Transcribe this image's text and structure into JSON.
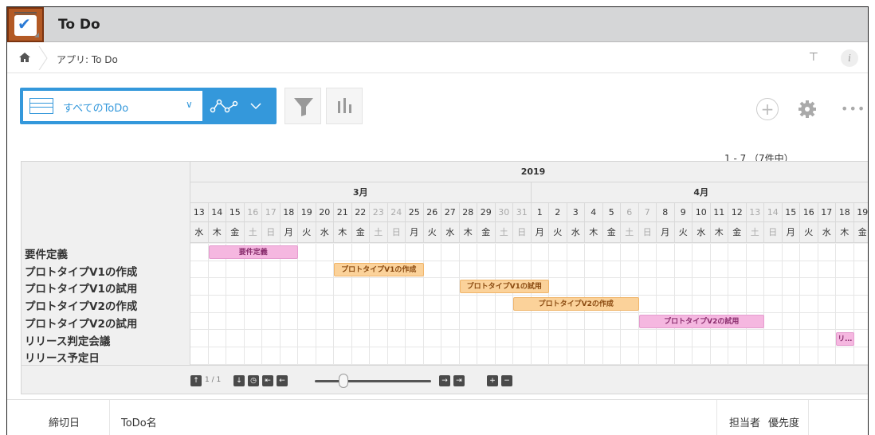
{
  "app": {
    "title": "To Do"
  },
  "breadcrumb": {
    "text": "アプリ: To Do"
  },
  "toolbar": {
    "view_name": "すべてのToDo"
  },
  "pager": {
    "count": "1 - 7 （7件中）"
  },
  "gantt": {
    "year": "2019",
    "months": [
      {
        "label": "3月"
      },
      {
        "label": "4月"
      }
    ],
    "days": [
      "13",
      "14",
      "15",
      "16",
      "17",
      "18",
      "19",
      "20",
      "21",
      "22",
      "23",
      "24",
      "25",
      "26",
      "27",
      "28",
      "29",
      "30",
      "31",
      "1",
      "2",
      "3",
      "4",
      "5",
      "6",
      "7",
      "8",
      "9",
      "10",
      "11",
      "12",
      "13",
      "14",
      "15",
      "16",
      "17",
      "18",
      "19"
    ],
    "weekdays": [
      "水",
      "木",
      "金",
      "土",
      "日",
      "月",
      "火",
      "水",
      "木",
      "金",
      "土",
      "日",
      "月",
      "火",
      "水",
      "木",
      "金",
      "土",
      "日",
      "月",
      "火",
      "水",
      "木",
      "金",
      "土",
      "日",
      "月",
      "火",
      "水",
      "木",
      "金",
      "土",
      "日",
      "月",
      "火",
      "水",
      "木",
      "金"
    ],
    "tasks": [
      {
        "name": "要件定義",
        "bar_label": "要件定義",
        "start": 1,
        "span": 5,
        "color": "pink"
      },
      {
        "name": "プロトタイプV1の作成",
        "bar_label": "プロトタイプV1の作成",
        "start": 8,
        "span": 5,
        "color": "orange"
      },
      {
        "name": "プロトタイプV1の試用",
        "bar_label": "プロトタイプV1の試用",
        "start": 15,
        "span": 5,
        "color": "orange"
      },
      {
        "name": "プロトタイプV2の作成",
        "bar_label": "プロトタイプV2の作成",
        "start": 18,
        "span": 7,
        "color": "orange"
      },
      {
        "name": "プロトタイプV2の試用",
        "bar_label": "プロトタイプV2の試用",
        "start": 25,
        "span": 7,
        "color": "pink"
      },
      {
        "name": "リリース判定会議",
        "bar_label": "リ…",
        "start": 36,
        "span": 1,
        "color": "pink"
      },
      {
        "name": "リリース予定日",
        "bar_label": "",
        "start": -1,
        "span": 0,
        "color": "pink"
      }
    ],
    "page_indicator": "1 / 1"
  },
  "list": {
    "columns": {
      "deadline": "締切日",
      "name": "ToDo名",
      "assignee": "担当者",
      "priority": "優先度"
    }
  },
  "colors": {
    "accent": "#3498db",
    "bar_pink": "#f5b7e0",
    "bar_orange": "#fbd29a",
    "icon_bg": "#b35a25"
  }
}
